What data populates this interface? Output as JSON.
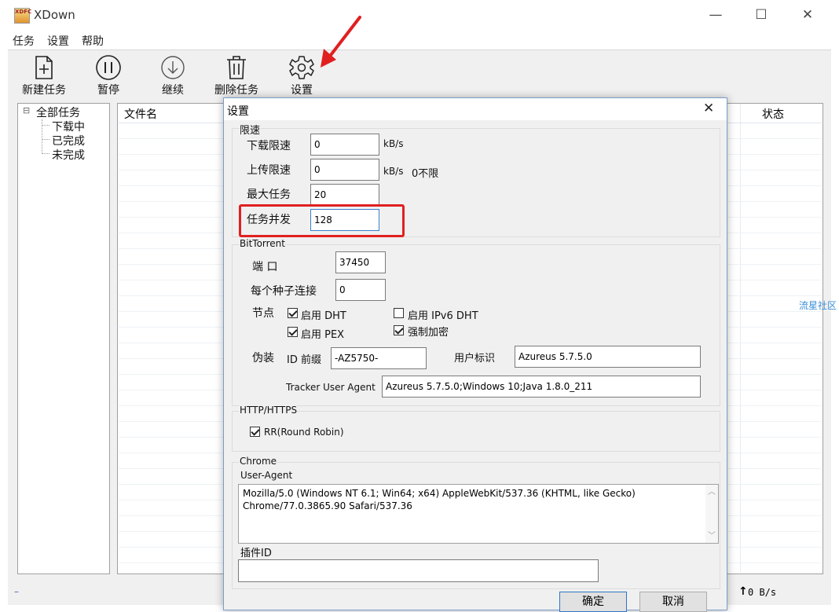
{
  "window": {
    "title": "XDown",
    "logo_text": "XDFC",
    "controls": {
      "minimize": "—",
      "maximize": "☐",
      "close": "✕"
    }
  },
  "menu": [
    "任务",
    "设置",
    "帮助"
  ],
  "toolbar": {
    "new_task": "新建任务",
    "pause": "暂停",
    "resume": "继续",
    "delete_task": "删除任务",
    "settings": "设置"
  },
  "tree": {
    "root": "全部任务",
    "toggle": "⊟",
    "children": [
      "下载中",
      "已完成",
      "未完成"
    ]
  },
  "list": {
    "columns": {
      "filename": "文件名",
      "status": "状态"
    }
  },
  "watermark": "流星社区",
  "status_bar": {
    "left": "–",
    "upload_speed": "0 B/s"
  },
  "dialog": {
    "title": "设置",
    "close": "✕",
    "speed_limit": {
      "group_title": "限速",
      "download_label": "下载限速",
      "download_value": "0",
      "download_unit": "kB/s",
      "upload_label": "上传限速",
      "upload_value": "0",
      "upload_unit": "kB/s",
      "upload_hint": "0不限",
      "max_tasks_label": "最大任务",
      "max_tasks_value": "20",
      "concurrency_label": "任务并发",
      "concurrency_value": "128"
    },
    "bittorrent": {
      "group_title": "BitTorrent",
      "port_label": "端 口",
      "port_value": "37450",
      "conn_label": "每个种子连接",
      "conn_value": "0",
      "node_label": "节点",
      "enable_dht": {
        "label": "启用 DHT",
        "checked": true
      },
      "enable_ipv6_dht": {
        "label": "启用 IPv6 DHT",
        "checked": false
      },
      "enable_pex": {
        "label": "启用 PEX",
        "checked": true
      },
      "force_encrypt": {
        "label": "强制加密",
        "checked": true
      },
      "disguise_label": "伪装",
      "id_prefix_label": "ID 前缀",
      "id_prefix_value": "-AZ5750-",
      "user_id_label": "用户标识",
      "user_id_value": "Azureus 5.7.5.0",
      "tracker_ua_label": "Tracker User Agent",
      "tracker_ua_value": "Azureus 5.7.5.0;Windows 10;Java 1.8.0_211"
    },
    "http": {
      "group_title": "HTTP/HTTPS",
      "round_robin": {
        "label": "RR(Round Robin)",
        "checked": true
      }
    },
    "chrome": {
      "group_title": "Chrome",
      "ua_label": "User-Agent",
      "ua_line1": "Mozilla/5.0 (Windows NT 6.1; Win64; x64) AppleWebKit/537.36 (KHTML, like Gecko)",
      "ua_line2": "Chrome/77.0.3865.90 Safari/537.36",
      "plugin_id_label": "插件ID",
      "plugin_id_value": ""
    },
    "ok_button": "确定",
    "cancel_button": "取消"
  },
  "colors": {
    "highlight": "#e02020",
    "arrow": "#e02020",
    "dialog_border": "#7a9cc8",
    "watermark": "#3a8fd8"
  }
}
